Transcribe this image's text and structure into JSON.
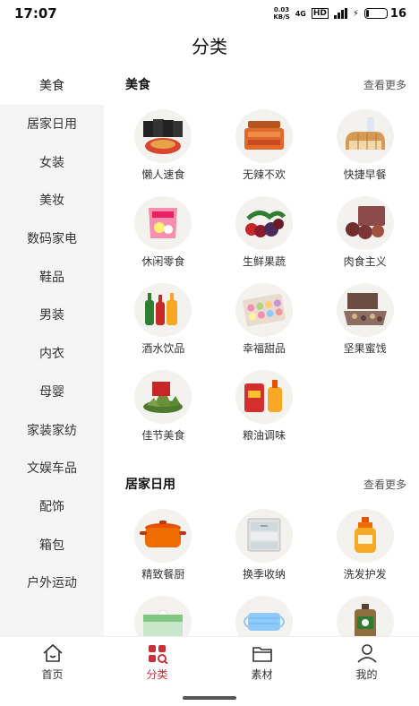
{
  "status_bar": {
    "time": "17:07",
    "net_speed_value": "0.03",
    "net_speed_unit": "KB/S",
    "network_type": "4G",
    "hd_label": "HD",
    "battery_level": "16",
    "battery_fraction": 0.16
  },
  "header": {
    "title": "分类"
  },
  "sidebar": {
    "active_index": 0,
    "items": [
      {
        "label": "美食"
      },
      {
        "label": "居家日用"
      },
      {
        "label": "女装"
      },
      {
        "label": "美妆"
      },
      {
        "label": "数码家电"
      },
      {
        "label": "鞋品"
      },
      {
        "label": "男装"
      },
      {
        "label": "内衣"
      },
      {
        "label": "母婴"
      },
      {
        "label": "家装家纺"
      },
      {
        "label": "文娱车品"
      },
      {
        "label": "配饰"
      },
      {
        "label": "箱包"
      },
      {
        "label": "户外运动"
      }
    ]
  },
  "sections": [
    {
      "title": "美食",
      "more_label": "查看更多",
      "items": [
        {
          "label": "懒人速食",
          "icon": "instant-noodles-icon"
        },
        {
          "label": "无辣不欢",
          "icon": "spicy-snacks-icon"
        },
        {
          "label": "快捷早餐",
          "icon": "bread-breakfast-icon"
        },
        {
          "label": "休闲零食",
          "icon": "snack-bag-icon"
        },
        {
          "label": "生鲜果蔬",
          "icon": "fresh-fruit-icon"
        },
        {
          "label": "肉食主义",
          "icon": "meat-icon"
        },
        {
          "label": "酒水饮品",
          "icon": "drink-bottles-icon"
        },
        {
          "label": "幸福甜品",
          "icon": "macaron-box-icon"
        },
        {
          "label": "坚果蜜饯",
          "icon": "nut-box-icon"
        },
        {
          "label": "佳节美食",
          "icon": "zongzi-icon"
        },
        {
          "label": "粮油调味",
          "icon": "rice-oil-icon"
        }
      ]
    },
    {
      "title": "居家日用",
      "more_label": "查看更多",
      "items": [
        {
          "label": "精致餐厨",
          "icon": "cooking-pot-icon"
        },
        {
          "label": "换季收纳",
          "icon": "storage-drawer-icon"
        },
        {
          "label": "洗发护发",
          "icon": "shampoo-bottle-icon"
        },
        {
          "label": "",
          "icon": "tissue-box-icon"
        },
        {
          "label": "",
          "icon": "face-mask-icon"
        },
        {
          "label": "",
          "icon": "disinfectant-bottle-icon"
        }
      ]
    }
  ],
  "tabbar": {
    "active_index": 1,
    "accent_color": "#c8303a",
    "tabs": [
      {
        "label": "首页",
        "icon": "home-icon"
      },
      {
        "label": "分类",
        "icon": "category-icon"
      },
      {
        "label": "素材",
        "icon": "folder-icon"
      },
      {
        "label": "我的",
        "icon": "user-icon"
      }
    ]
  }
}
